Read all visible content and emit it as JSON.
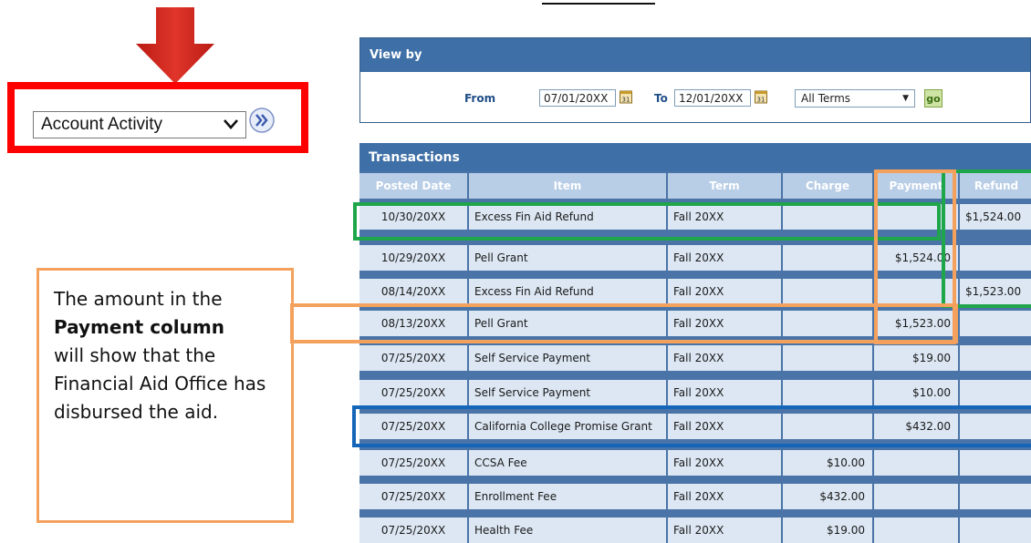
{
  "colors": {
    "accent_red": "#ff0000",
    "arrow_red": "#d9281e",
    "header_blue": "#3e6fa6",
    "orange_highlight": "#f4a15d",
    "green_highlight": "#1fa64a",
    "blue_highlight": "#1565b8"
  },
  "dropdown": {
    "selected": "Account Activity"
  },
  "callout": {
    "line1": "The amount in the",
    "bold": "Payment column",
    "line3": "will show that the Financial Aid Office has disbursed the aid."
  },
  "view_by": {
    "title": "View by",
    "from_label": "From",
    "from_value": "07/01/20XX",
    "to_label": "To",
    "to_value": "12/01/20XX",
    "term_selected": "All Terms",
    "go_label": "go"
  },
  "transactions": {
    "title": "Transactions",
    "columns": [
      "Posted Date",
      "Item",
      "Term",
      "Charge",
      "Payment",
      "Refund"
    ],
    "rows": [
      [
        "10/30/20XX",
        "Excess Fin Aid Refund",
        "Fall 20XX",
        "",
        "",
        "$1,524.00"
      ],
      [
        "10/29/20XX",
        "Pell Grant",
        "Fall 20XX",
        "",
        "$1,524.00",
        ""
      ],
      [
        "08/14/20XX",
        "Excess Fin Aid Refund",
        "Fall 20XX",
        "",
        "",
        "$1,523.00"
      ],
      [
        "08/13/20XX",
        "Pell Grant",
        "Fall 20XX",
        "",
        "$1,523.00",
        ""
      ],
      [
        "07/25/20XX",
        "Self Service Payment",
        "Fall 20XX",
        "",
        "$19.00",
        ""
      ],
      [
        "07/25/20XX",
        "Self Service Payment",
        "Fall 20XX",
        "",
        "$10.00",
        ""
      ],
      [
        "07/25/20XX",
        "California College Promise Grant",
        "Fall 20XX",
        "",
        "$432.00",
        ""
      ],
      [
        "07/25/20XX",
        "CCSA Fee",
        "Fall 20XX",
        "$10.00",
        "",
        ""
      ],
      [
        "07/25/20XX",
        "Enrollment Fee",
        "Fall 20XX",
        "$432.00",
        "",
        ""
      ],
      [
        "07/25/20XX",
        "Health Fee",
        "Fall 20XX",
        "$19.00",
        "",
        ""
      ]
    ]
  }
}
